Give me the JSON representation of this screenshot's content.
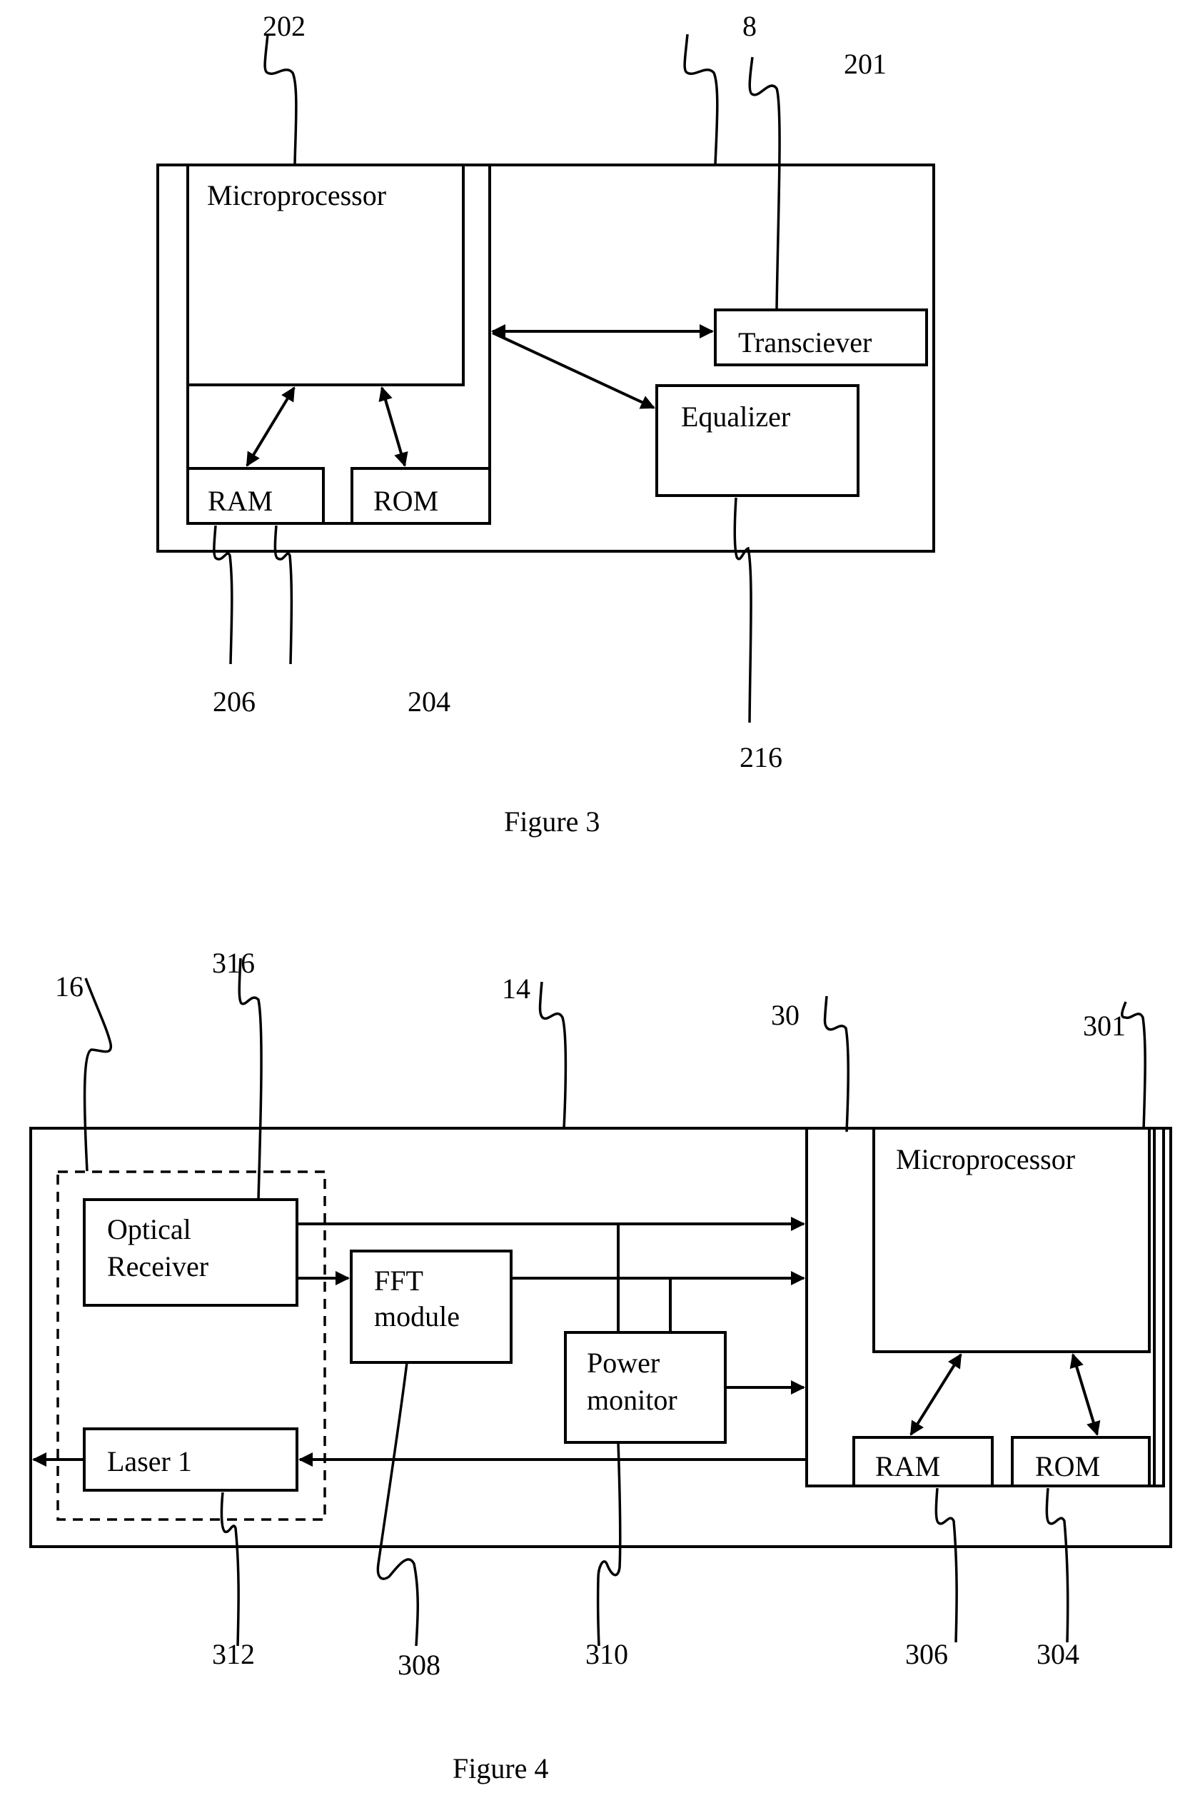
{
  "figure3": {
    "caption": "Figure 3",
    "blocks": {
      "microprocessor": "Microprocessor",
      "ram": "RAM",
      "rom": "ROM",
      "transceiver": "Transciever",
      "equalizer": "Equalizer"
    },
    "refs": {
      "microprocessor": "202",
      "device": "8",
      "transceiver": "201",
      "ram": "206",
      "rom": "204",
      "equalizer": "216"
    }
  },
  "figure4": {
    "caption": "Figure 4",
    "blocks": {
      "optical_receiver_line1": "Optical",
      "optical_receiver_line2": "Receiver",
      "fft_line1": "FFT",
      "fft_line2": "module",
      "power_line1": "Power",
      "power_line2": "monitor",
      "laser": "Laser 1",
      "microprocessor": "Microprocessor",
      "ram": "RAM",
      "rom": "ROM"
    },
    "refs": {
      "transceiver_unit": "16",
      "optical_receiver": "316",
      "device": "14",
      "controller": "30",
      "microprocessor": "301",
      "laser": "312",
      "fft": "308",
      "power_monitor": "310",
      "ram": "306",
      "rom": "304"
    }
  }
}
